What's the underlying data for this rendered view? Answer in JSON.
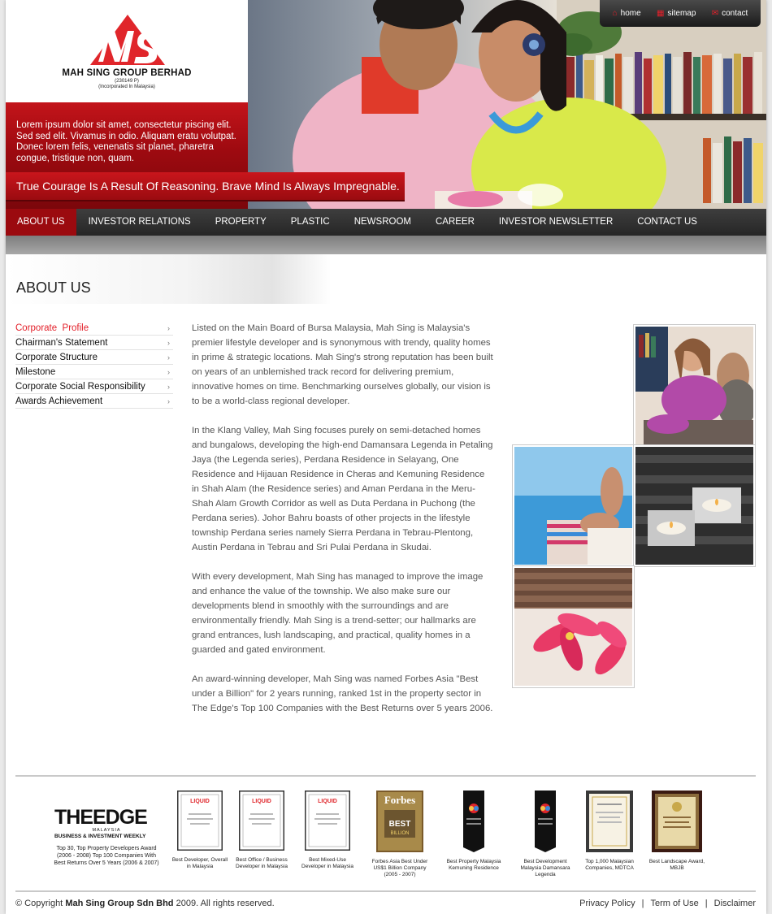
{
  "brand": {
    "name": "MAH SING GROUP BERHAD",
    "reg_no": "(230149 P)",
    "incorporated": "(Incorporated In Malaysia)"
  },
  "header": {
    "intro": "Lorem ipsum dolor sit amet, consectetur piscing elit. Sed sed elit. Vivamus in odio. Aliquam eratu volutpat. Donec lorem felis, venenatis sit planet, pharetra congue, tristique non, quam.",
    "tagline": "True Courage Is A Result Of Reasoning. Brave Mind Is Always Impregnable."
  },
  "toplinks": [
    {
      "label": "home",
      "icon": "home-icon"
    },
    {
      "label": "sitemap",
      "icon": "sitemap-icon"
    },
    {
      "label": "contact",
      "icon": "mail-icon"
    }
  ],
  "nav": [
    {
      "label": "ABOUT US",
      "active": true
    },
    {
      "label": "INVESTOR RELATIONS"
    },
    {
      "label": "PROPERTY"
    },
    {
      "label": "PLASTIC"
    },
    {
      "label": "NEWSROOM"
    },
    {
      "label": "CAREER"
    },
    {
      "label": "INVESTOR NEWSLETTER"
    },
    {
      "label": "CONTACT US"
    }
  ],
  "page_title": "ABOUT US",
  "sidebar": [
    {
      "label": "Corporate  Profile",
      "active": true
    },
    {
      "label": "Chairman's Statement"
    },
    {
      "label": "Corporate Structure"
    },
    {
      "label": "Milestone"
    },
    {
      "label": "Corporate Social Responsibility"
    },
    {
      "label": "Awards Achievement"
    }
  ],
  "content": [
    "Listed on the Main Board of Bursa Malaysia, Mah Sing is Malaysia's premier lifestyle developer and is synonymous with trendy, quality homes in prime & strategic locations.  Mah Sing's strong reputation has been built on years of an unblemished track record for delivering premium, innovative homes on time.  Benchmarking ourselves globally, our vision is to be a world-class regional developer.",
    "In the Klang Valley, Mah Sing focuses purely on semi-detached homes and bungalows, developing the high-end Damansara Legenda in Petaling Jaya (the Legenda series), Perdana Residence in Selayang, One Residence and Hijauan Residence in Cheras and Kemuning Residence in Shah Alam (the Residence series) and Aman Perdana in the Meru-Shah Alam Growth Corridor as well as Duta Perdana in Puchong (the Perdana series).  Johor Bahru boasts of other projects in the lifestyle township Perdana series namely Sierra Perdana in Tebrau-Plentong, Austin Perdana in Tebrau and Sri Pulai Perdana in Skudai.",
    "With every development, Mah Sing has managed to improve the image and enhance the value of the township.  We also make sure our developments blend in smoothly with the surroundings and are environmentally friendly.  Mah Sing is a trend-setter; our hallmarks are grand entrances, lush landscaping, and practical, quality homes in a guarded and gated environment.",
    "An award-winning developer, Mah Sing was named Forbes Asia \"Best under a Billion\" for 2 years running, ranked 1st in the property sector in The Edge's Top 100 Companies with the Best Returns over 5 years 2006."
  ],
  "edge_award": {
    "title": "THEEDGE",
    "country": "MALAYSIA",
    "tagline": "BUSINESS & INVESTMENT WEEKLY",
    "caption": "Top 30, Top Property Developers Award (2006 - 2008) Top 100 Companies With Best Returns Over 5 Years (2006 & 2007)"
  },
  "awards": [
    {
      "caption": "Best Developer, Overall in Malaysia",
      "style": "liquid"
    },
    {
      "caption": "Best Office / Business Developer in Malaysia",
      "style": "liquid"
    },
    {
      "caption": "Best Mixed-Use Developer in Malaysia",
      "style": "liquid"
    },
    {
      "caption": "Forbes Asia Best Under US$1 Billion Company (2005 - 2007)",
      "style": "forbes"
    },
    {
      "caption": "Best Property Malaysia Kemuning Residence",
      "style": "cnbc"
    },
    {
      "caption": "Best Development Malaysia Damansara Legenda",
      "style": "cnbc"
    },
    {
      "caption": "Top 1,000 Malaysian Companies, MDTCA",
      "style": "certificate"
    },
    {
      "caption": "Best Landscape Award, MBJB",
      "style": "plaque"
    }
  ],
  "award_badges": {
    "liquid": "LIQUID",
    "forbes": "Forbes",
    "forbes_best": "BEST",
    "forbes_billion": "BILLION"
  },
  "footer": {
    "copyright_prefix": "© Copyright",
    "company": "Mah Sing Group Sdn Bhd",
    "copyright_suffix": "2009. All rights reserved.",
    "links": [
      "Privacy Policy",
      "Term of Use",
      "Disclaimer"
    ]
  },
  "colors": {
    "brand_red": "#c3141a",
    "nav_dark": "#2e2e2e",
    "nav_active": "#9b0a0f",
    "link_red": "#e3202a"
  }
}
